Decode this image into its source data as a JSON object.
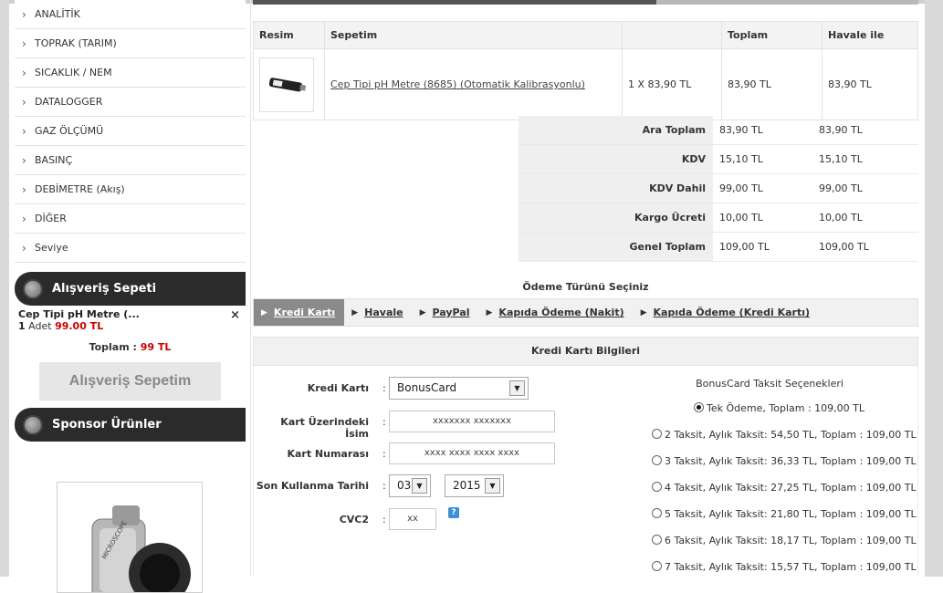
{
  "sidebar": {
    "categories": [
      "ANALİTİK",
      "TOPRAK (TARIM)",
      "SICAKLIK / NEM",
      "DATALOGGER",
      "GAZ ÖLÇÜMÜ",
      "BASINÇ",
      "DEBİMETRE (Akış)",
      "DİĞER",
      "Seviye"
    ],
    "cart_title": "Alışveriş Sepeti",
    "cart_item": {
      "name": "Cep Tipi pH Metre (...",
      "remove": "×",
      "qty": "1",
      "qty_label": "Adet",
      "price": "99.00 TL"
    },
    "cart_total_label": "Toplam :",
    "cart_total_value": "99 TL",
    "cart_button": "Alışveriş Sepetim",
    "sponsor_title": "Sponsor Ürünler"
  },
  "cart_table": {
    "headers": [
      "Resim",
      "Sepetim",
      "",
      "Toplam",
      "Havale ile"
    ],
    "product": {
      "name": "Cep Tipi pH Metre (8685) (Otomatik Kalibrasyonlu)",
      "qty_price": "1 X 83,90 TL",
      "total": "83,90 TL",
      "havale": "83,90 TL"
    }
  },
  "summary": [
    {
      "label": "Ara Toplam",
      "v1": "83,90 TL",
      "v2": "83,90 TL"
    },
    {
      "label": "KDV",
      "v1": "15,10 TL",
      "v2": "15,10 TL"
    },
    {
      "label": "KDV Dahil",
      "v1": "99,00 TL",
      "v2": "99,00 TL"
    },
    {
      "label": "Kargo Ücreti",
      "v1": "10,00 TL",
      "v2": "10,00 TL"
    },
    {
      "label": "Genel Toplam",
      "v1": "109,00 TL",
      "v2": "109,00 TL"
    }
  ],
  "payment": {
    "title": "Ödeme Türünü Seçiniz",
    "tabs": [
      "Kredi Kartı",
      "Havale",
      "PayPal",
      "Kapıda Ödeme (Nakit)",
      "Kapıda Ödeme (Kredi Kartı)"
    ],
    "active_tab": 0
  },
  "credit_card": {
    "section_title": "Kredi Kartı Bilgileri",
    "card_label": "Kredi Kartı",
    "card_value": "BonusCard",
    "name_label": "Kart Üzerindeki İsim",
    "name_placeholder": "xxxxxxx xxxxxxx",
    "number_label": "Kart Numarası",
    "number_placeholder": "xxxx xxxx xxxx xxxx",
    "expiry_label": "Son Kullanma Tarihi",
    "expiry_month": "03",
    "expiry_year": "2015",
    "cvc_label": "CVC2",
    "cvc_placeholder": "xx",
    "help": "?",
    "colon": ":"
  },
  "installments": {
    "title": "BonusCard Taksit Seçenekleri",
    "options": [
      "Tek Ödeme, Toplam : 109,00 TL",
      "2 Taksit, Aylık Taksit: 54,50 TL, Toplam : 109,00 TL",
      "3 Taksit, Aylık Taksit: 36,33 TL, Toplam : 109,00 TL",
      "4 Taksit, Aylık Taksit: 27,25 TL, Toplam : 109,00 TL",
      "5 Taksit, Aylık Taksit: 21,80 TL, Toplam : 109,00 TL",
      "6 Taksit, Aylık Taksit: 18,17 TL, Toplam : 109,00 TL",
      "7 Taksit, Aylık Taksit: 15,57 TL, Toplam : 109,00 TL"
    ],
    "selected": 0
  }
}
